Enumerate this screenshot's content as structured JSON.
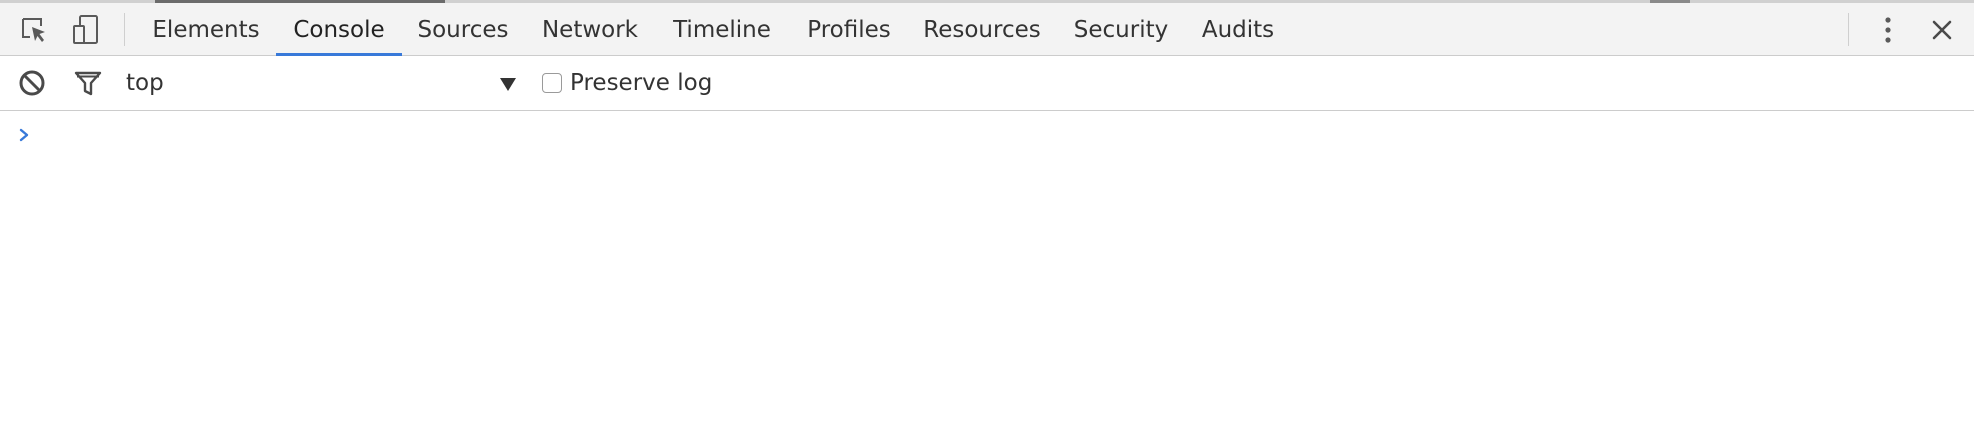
{
  "toolbar": {
    "tabs": [
      {
        "label": "Elements",
        "selected": false
      },
      {
        "label": "Console",
        "selected": true
      },
      {
        "label": "Sources",
        "selected": false
      },
      {
        "label": "Network",
        "selected": false
      },
      {
        "label": "Timeline",
        "selected": false
      },
      {
        "label": "Profiles",
        "selected": false
      },
      {
        "label": "Resources",
        "selected": false
      },
      {
        "label": "Security",
        "selected": false
      },
      {
        "label": "Audits",
        "selected": false
      }
    ],
    "icons": {
      "inspect": "inspect-element-icon",
      "device": "device-mode-icon",
      "menu": "more-menu-icon",
      "close": "close-icon"
    }
  },
  "filterbar": {
    "context_value": "top",
    "preserve_log_label": "Preserve log",
    "preserve_log_checked": false,
    "icons": {
      "clear": "clear-console-icon",
      "filter": "filter-icon"
    }
  },
  "console": {
    "prompt_icon": "prompt-chevron-icon",
    "input_value": ""
  },
  "colors": {
    "accent": "#3879d9",
    "toolbar_bg": "#f3f3f3",
    "border": "#cccccc"
  }
}
